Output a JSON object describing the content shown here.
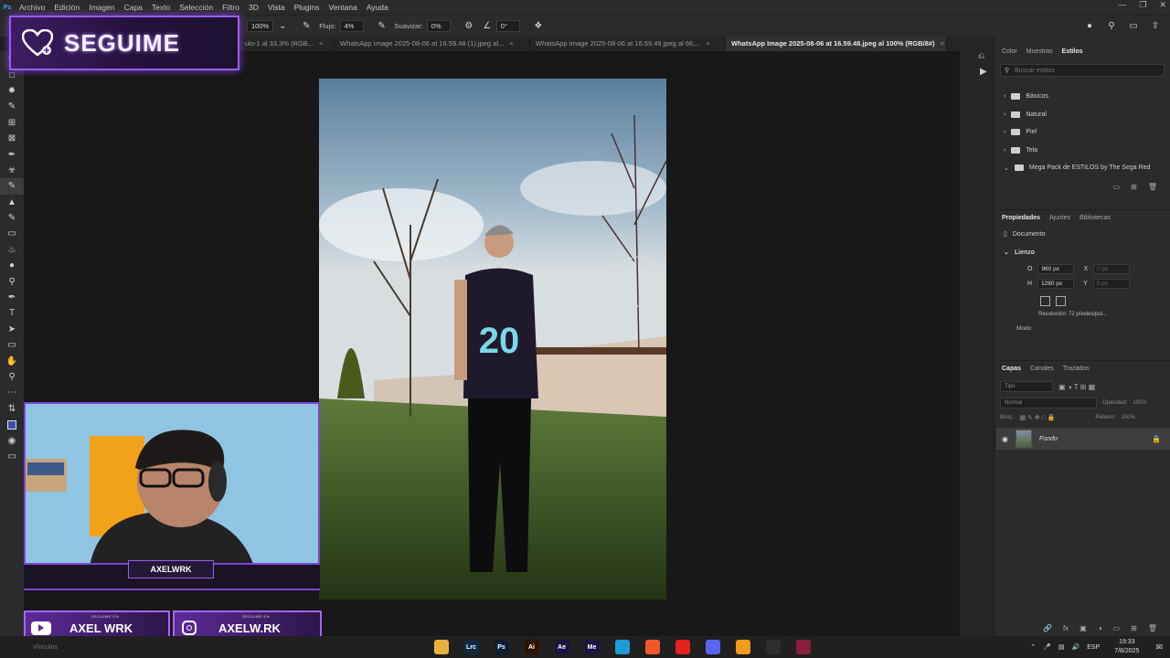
{
  "menu": {
    "items": [
      "Archivo",
      "Edición",
      "Imagen",
      "Capa",
      "Texto",
      "Selección",
      "Filtro",
      "3D",
      "Vista",
      "Plugins",
      "Ventana",
      "Ayuda"
    ],
    "logo": "Ps"
  },
  "options": {
    "opacity_partial": "ulo-1 al 33,3% (RGB...",
    "opacity_value": "100%",
    "flow_label": "Flujo:",
    "flow_value": "4%",
    "smooth_label": "Suavizar:",
    "smooth_value": "0%",
    "angle_value": "0°"
  },
  "tabs": [
    {
      "label": "WhatsApp Image 2025-08-06 at 16.59.48 (1).jpeg al...",
      "active": false
    },
    {
      "label": "WhatsApp Image 2025-08-06 at 16.59.49.jpeg al 66,...",
      "active": false
    },
    {
      "label": "WhatsApp Image 2025-08-06 at 16.59.48.jpeg al 100% (RGB/8#)",
      "active": true
    }
  ],
  "styles_panel": {
    "tabs": [
      "Color",
      "Muestras",
      "Estilos"
    ],
    "search_placeholder": "Buscar estilos",
    "folders": [
      "Básicos",
      "Natural",
      "Piel",
      "Tela",
      "Mega Pack de ESTILOS by The Sega Red"
    ]
  },
  "properties_panel": {
    "tabs": [
      "Propiedades",
      "Ajustes",
      "Bibliotecas"
    ],
    "doc_label": "Documento",
    "section": "Lienzo",
    "w_label": "O",
    "w_value": "960 px",
    "h_label": "H",
    "h_value": "1280 px",
    "x_label": "X",
    "x_value": "0 px",
    "y_label": "Y",
    "y_value": "0 px",
    "resolution": "Resolución: 72 píxeles/pul...",
    "mode": "Modo"
  },
  "layers_panel": {
    "tabs": [
      "Capas",
      "Canales",
      "Trazados"
    ],
    "filter_placeholder": "Tipo",
    "blend_mode": "Normal",
    "opacity_label": "Opacidad:",
    "opacity_value": "100%",
    "lock_label": "Bloq.:",
    "fill_label": "Relleno:",
    "fill_value": "100%",
    "layer_name": "Fondo"
  },
  "overlay": {
    "follow_text": "SEGUIME",
    "cam_name": "AXELWRK",
    "youtube_small": "SEGUIME EN",
    "youtube_name": "AXEL WRK",
    "instagram_small": "SEGUIME EN",
    "instagram_name": "AXELW.RK"
  },
  "taskbar": {
    "search_partial": "Vínculos",
    "apps": [
      {
        "name": "explorer",
        "label": "",
        "color": "#e8b23a"
      },
      {
        "name": "lightroom-classic",
        "label": "Lrc",
        "color": "#0e2a44"
      },
      {
        "name": "photoshop",
        "label": "Ps",
        "color": "#0a1f33"
      },
      {
        "name": "illustrator",
        "label": "Ai",
        "color": "#2e1300"
      },
      {
        "name": "after-effects",
        "label": "Ae",
        "color": "#1e1243"
      },
      {
        "name": "media-encoder",
        "label": "Me",
        "color": "#1e1243"
      },
      {
        "name": "edge",
        "label": "",
        "color": "#1d9bd6"
      },
      {
        "name": "brave",
        "label": "",
        "color": "#f0582a"
      },
      {
        "name": "youtube-music",
        "label": "",
        "color": "#e62020"
      },
      {
        "name": "discord",
        "label": "",
        "color": "#5865f2"
      },
      {
        "name": "fl-studio",
        "label": "",
        "color": "#f29b1d"
      },
      {
        "name": "obs",
        "label": "",
        "color": "#2d2d2d"
      },
      {
        "name": "winrar",
        "label": "",
        "color": "#8b1d3d"
      }
    ],
    "lang": "ESP",
    "time": "19:33",
    "date": "7/8/2025"
  },
  "colors": {
    "accent_purple": "#9b5cf0",
    "ps_blue": "#31a8ff",
    "panel_bg": "#2b2b2b"
  }
}
